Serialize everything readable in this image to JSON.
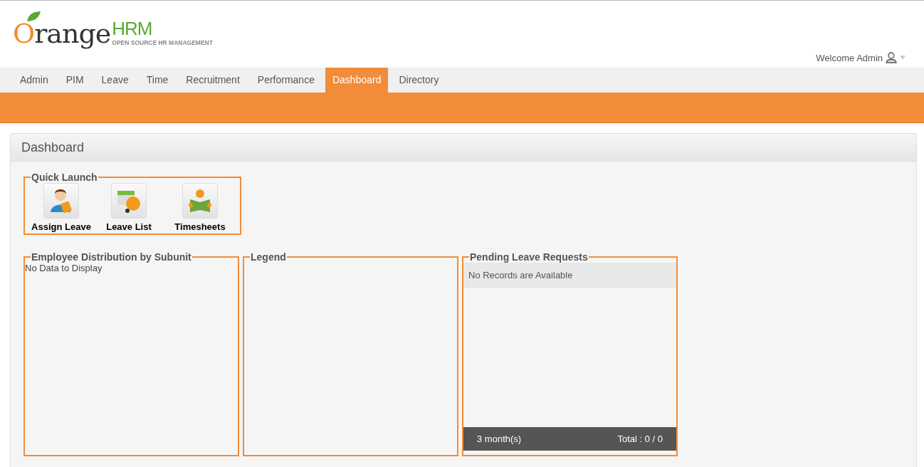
{
  "logo": {
    "brand": "Orange",
    "suffix": "HRM",
    "tagline": "OPEN SOURCE HR MANAGEMENT"
  },
  "welcome": "Welcome Admin",
  "nav": [
    {
      "label": "Admin",
      "selected": false
    },
    {
      "label": "PIM",
      "selected": false
    },
    {
      "label": "Leave",
      "selected": false
    },
    {
      "label": "Time",
      "selected": false
    },
    {
      "label": "Recruitment",
      "selected": false
    },
    {
      "label": "Performance",
      "selected": false
    },
    {
      "label": "Dashboard",
      "selected": true
    },
    {
      "label": "Directory",
      "selected": false
    }
  ],
  "panel": {
    "title": "Dashboard"
  },
  "quick_launch": {
    "title": "Quick Launch",
    "items": [
      {
        "label": "Assign Leave",
        "kind": "assign"
      },
      {
        "label": "Leave List",
        "kind": "list"
      },
      {
        "label": "Timesheets",
        "kind": "timesheet"
      }
    ]
  },
  "employee_distribution": {
    "title": "Employee Distribution by Subunit",
    "message": "No Data to Display"
  },
  "legend": {
    "title": "Legend"
  },
  "pending_leave": {
    "title": "Pending Leave Requests",
    "message": "No Records are Available",
    "period": "3 month(s)",
    "total": "Total : 0 / 0"
  }
}
